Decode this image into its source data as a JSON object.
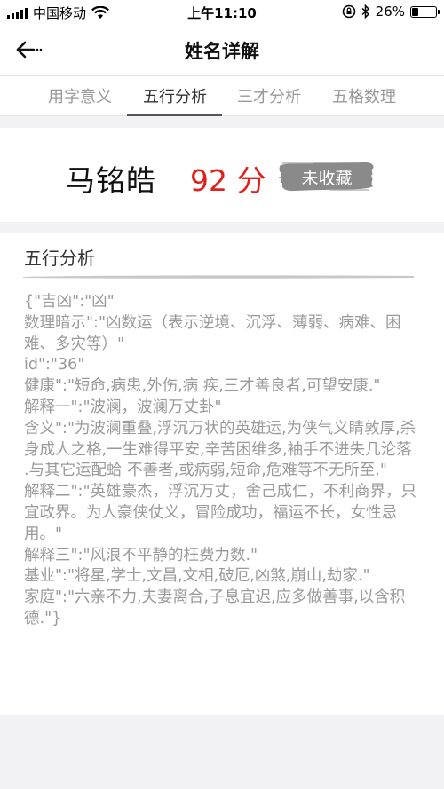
{
  "status_bar": {
    "carrier": "中国移动",
    "time": "上午11:10",
    "battery": "26%",
    "battery_level": 0.26
  },
  "nav": {
    "title": "姓名详解",
    "back_icon": "back-arrow-icon"
  },
  "tabs": [
    {
      "label": "用字意义",
      "active": false
    },
    {
      "label": "五行分析",
      "active": true
    },
    {
      "label": "三才分析",
      "active": false
    },
    {
      "label": "五格数理",
      "active": false
    }
  ],
  "name_card": {
    "name": "马铭皓",
    "score": "92 分",
    "favorite_label": "未收藏"
  },
  "analysis": {
    "title": "五行分析",
    "lines": [
      "{\"吉凶\":\"凶\"",
      "数理暗示\":\"凶数运（表示逆境、沉浮、薄弱、病难、困难、多灾等）\"",
      "id\":\"36\"",
      "健康\":\"短命,病患,外伤,病 疾,三才善良者,可望安康.\"",
      "解释一\":\"波澜，波澜万丈卦\"",
      "含义\":\"为波澜重叠,浮沉万状的英雄运,为侠气义睛敦厚,杀身成人之格,一生难得平安,辛苦困维多,袖手不进失几沦落 .与其它运配蛤 不善者,或病弱,短命,危难等不无所至.\"",
      "解释二\":\"英雄豪杰，浮沉万丈，舍己成仁，不利商界，只宜政界。为人豪侠仗义，冒险成功，福运不长，女性忌用。\"",
      "解释三\":\"风浪不平静的枉费力数.\"",
      "基业\":\"将星,学士,文昌,文相,破厄,凶煞,崩山,劫家.\"",
      "家庭\":\"六亲不力,夫妻离合,子息宜迟,应多做善事,以含积德.\"}"
    ]
  },
  "colors": {
    "score": "#e0201b",
    "tab_active": "#333333",
    "tab_inactive": "#999999",
    "body_text": "#9a9a9a",
    "background": "#f2f2f4"
  }
}
